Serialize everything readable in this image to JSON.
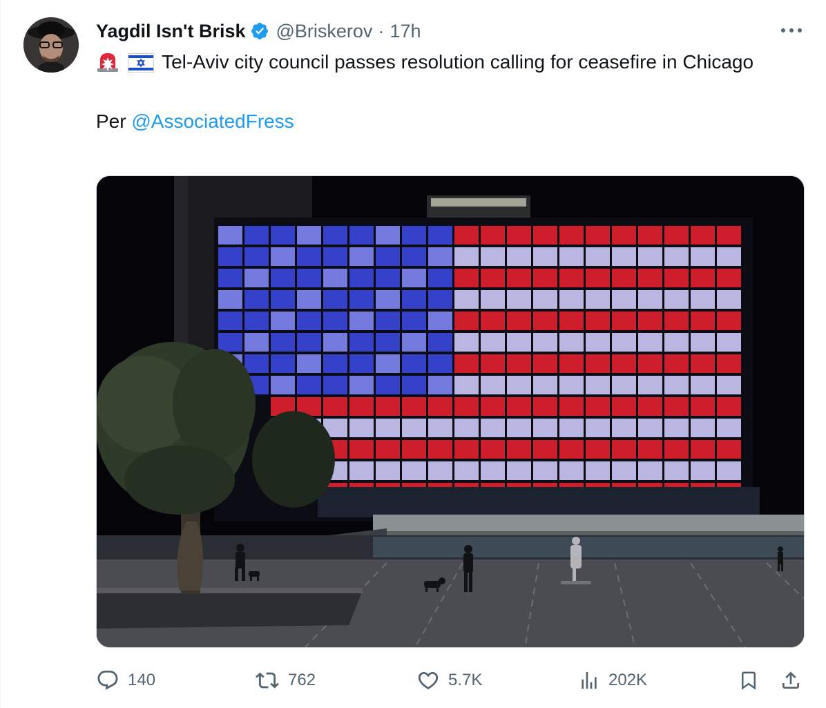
{
  "author": {
    "display_name": "Yagdil Isn't Brisk",
    "handle": "@Briskerov",
    "separator": "·",
    "time": "17h",
    "avatar_icon": "avatar-photo",
    "verified_icon": "verified-badge-icon"
  },
  "tweet": {
    "emojis": [
      "police-light-emoji",
      "israel-flag-emoji"
    ],
    "text_line": "Tel-Aviv city council passes resolution calling for ceasefire in Chicago",
    "per_label": "Per",
    "mention": "@AssociatedFress"
  },
  "media": {
    "description_icon": "photo-tel-aviv-city-hall-lit-as-us-flag"
  },
  "actions": {
    "replies": "140",
    "retweets": "762",
    "likes": "5.7K",
    "views": "202K"
  },
  "colors": {
    "text": "#0f1419",
    "muted": "#536471",
    "accent": "#1d9bf0",
    "flag_red": "#e0202e",
    "flag_blue": "#3a46d8"
  }
}
